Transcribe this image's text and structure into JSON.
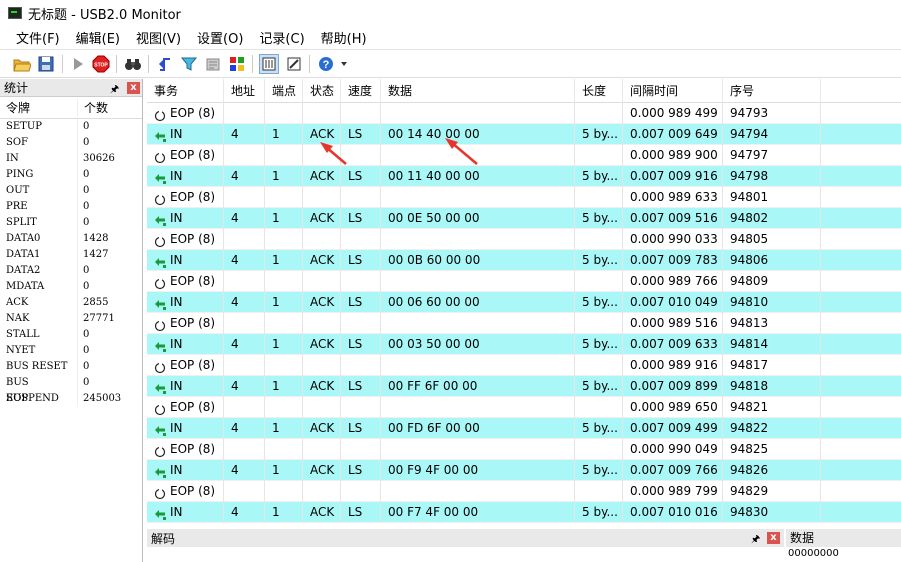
{
  "window": {
    "title": "无标题 - USB2.0 Monitor"
  },
  "menu": [
    "文件(F)",
    "编辑(E)",
    "视图(V)",
    "设置(O)",
    "记录(C)",
    "帮助(H)"
  ],
  "stats": {
    "title": "统计",
    "col_token": "令牌",
    "col_count": "个数",
    "rows": [
      {
        "name": "SETUP",
        "value": "0"
      },
      {
        "name": "SOF",
        "value": "0"
      },
      {
        "name": "IN",
        "value": "30626"
      },
      {
        "name": "PING",
        "value": "0"
      },
      {
        "name": "OUT",
        "value": "0"
      },
      {
        "name": "PRE",
        "value": "0"
      },
      {
        "name": "SPLIT",
        "value": "0"
      },
      {
        "name": "DATA0",
        "value": "1428"
      },
      {
        "name": "DATA1",
        "value": "1427"
      },
      {
        "name": "DATA2",
        "value": "0"
      },
      {
        "name": "MDATA",
        "value": "0"
      },
      {
        "name": "ACK",
        "value": "2855"
      },
      {
        "name": "NAK",
        "value": "27771"
      },
      {
        "name": "STALL",
        "value": "0"
      },
      {
        "name": "NYET",
        "value": "0"
      },
      {
        "name": "BUS RESET",
        "value": "0"
      },
      {
        "name": "BUS SUSPEND",
        "value": "0"
      },
      {
        "name": "EOP",
        "value": "245003"
      }
    ]
  },
  "grid": {
    "columns": [
      "事务",
      "地址",
      "端点",
      "状态",
      "速度",
      "数据",
      "长度",
      "间隔时间",
      "序号"
    ],
    "rows": [
      {
        "type": "eop",
        "event": "EOP (8)",
        "addr": "",
        "ep": "",
        "status": "",
        "speed": "",
        "data": "",
        "len": "",
        "interval": "0.000 989 499",
        "seq": "94793"
      },
      {
        "type": "in",
        "event": "IN",
        "addr": "4",
        "ep": "1",
        "status": "ACK",
        "speed": "LS",
        "data": "00 14 40 00 00",
        "len": "5 by...",
        "interval": "0.007 009 649",
        "seq": "94794"
      },
      {
        "type": "eop",
        "event": "EOP (8)",
        "addr": "",
        "ep": "",
        "status": "",
        "speed": "",
        "data": "",
        "len": "",
        "interval": "0.000 989 900",
        "seq": "94797"
      },
      {
        "type": "in",
        "event": "IN",
        "addr": "4",
        "ep": "1",
        "status": "ACK",
        "speed": "LS",
        "data": "00 11 40 00 00",
        "len": "5 by...",
        "interval": "0.007 009 916",
        "seq": "94798"
      },
      {
        "type": "eop",
        "event": "EOP (8)",
        "addr": "",
        "ep": "",
        "status": "",
        "speed": "",
        "data": "",
        "len": "",
        "interval": "0.000 989 633",
        "seq": "94801"
      },
      {
        "type": "in",
        "event": "IN",
        "addr": "4",
        "ep": "1",
        "status": "ACK",
        "speed": "LS",
        "data": "00 0E 50 00 00",
        "len": "5 by...",
        "interval": "0.007 009 516",
        "seq": "94802"
      },
      {
        "type": "eop",
        "event": "EOP (8)",
        "addr": "",
        "ep": "",
        "status": "",
        "speed": "",
        "data": "",
        "len": "",
        "interval": "0.000 990 033",
        "seq": "94805"
      },
      {
        "type": "in",
        "event": "IN",
        "addr": "4",
        "ep": "1",
        "status": "ACK",
        "speed": "LS",
        "data": "00 0B 60 00 00",
        "len": "5 by...",
        "interval": "0.007 009 783",
        "seq": "94806"
      },
      {
        "type": "eop",
        "event": "EOP (8)",
        "addr": "",
        "ep": "",
        "status": "",
        "speed": "",
        "data": "",
        "len": "",
        "interval": "0.000 989 766",
        "seq": "94809"
      },
      {
        "type": "in",
        "event": "IN",
        "addr": "4",
        "ep": "1",
        "status": "ACK",
        "speed": "LS",
        "data": "00 06 60 00 00",
        "len": "5 by...",
        "interval": "0.007 010 049",
        "seq": "94810"
      },
      {
        "type": "eop",
        "event": "EOP (8)",
        "addr": "",
        "ep": "",
        "status": "",
        "speed": "",
        "data": "",
        "len": "",
        "interval": "0.000 989 516",
        "seq": "94813"
      },
      {
        "type": "in",
        "event": "IN",
        "addr": "4",
        "ep": "1",
        "status": "ACK",
        "speed": "LS",
        "data": "00 03 50 00 00",
        "len": "5 by...",
        "interval": "0.007 009 633",
        "seq": "94814"
      },
      {
        "type": "eop",
        "event": "EOP (8)",
        "addr": "",
        "ep": "",
        "status": "",
        "speed": "",
        "data": "",
        "len": "",
        "interval": "0.000 989 916",
        "seq": "94817"
      },
      {
        "type": "in",
        "event": "IN",
        "addr": "4",
        "ep": "1",
        "status": "ACK",
        "speed": "LS",
        "data": "00 FF 6F 00 00",
        "len": "5 by...",
        "interval": "0.007 009 899",
        "seq": "94818"
      },
      {
        "type": "eop",
        "event": "EOP (8)",
        "addr": "",
        "ep": "",
        "status": "",
        "speed": "",
        "data": "",
        "len": "",
        "interval": "0.000 989 650",
        "seq": "94821"
      },
      {
        "type": "in",
        "event": "IN",
        "addr": "4",
        "ep": "1",
        "status": "ACK",
        "speed": "LS",
        "data": "00 FD 6F 00 00",
        "len": "5 by...",
        "interval": "0.007 009 499",
        "seq": "94822"
      },
      {
        "type": "eop",
        "event": "EOP (8)",
        "addr": "",
        "ep": "",
        "status": "",
        "speed": "",
        "data": "",
        "len": "",
        "interval": "0.000 990 049",
        "seq": "94825"
      },
      {
        "type": "in",
        "event": "IN",
        "addr": "4",
        "ep": "1",
        "status": "ACK",
        "speed": "LS",
        "data": "00 F9 4F 00 00",
        "len": "5 by...",
        "interval": "0.007 009 766",
        "seq": "94826"
      },
      {
        "type": "eop",
        "event": "EOP (8)",
        "addr": "",
        "ep": "",
        "status": "",
        "speed": "",
        "data": "",
        "len": "",
        "interval": "0.000 989 799",
        "seq": "94829"
      },
      {
        "type": "in",
        "event": "IN",
        "addr": "4",
        "ep": "1",
        "status": "ACK",
        "speed": "LS",
        "data": "00 F7 4F 00 00",
        "len": "5 by...",
        "interval": "0.007 010 016",
        "seq": "94830"
      }
    ]
  },
  "decode": {
    "title": "解码"
  },
  "data_panel": {
    "title": "数据",
    "value": "00000000"
  },
  "colors": {
    "in_row": "#aaf7f7",
    "annotation_arrow": "#e8352b"
  },
  "icons": [
    "open-folder-icon",
    "save-icon",
    "play-icon",
    "stop-icon",
    "binoculars-icon",
    "trigger-icon",
    "filter-icon",
    "settings-icon",
    "colors-icon",
    "columns-icon",
    "edit-icon",
    "help-icon"
  ]
}
